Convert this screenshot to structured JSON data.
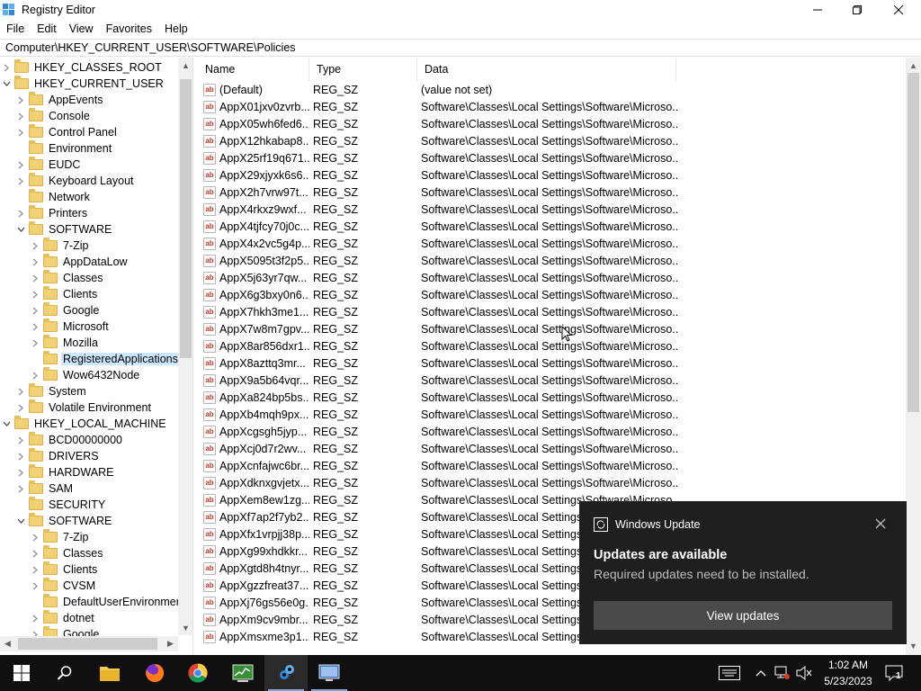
{
  "window": {
    "title": "Registry Editor",
    "minimize_glyph": "—",
    "maximize_glyph": "☐",
    "close_glyph": "✕"
  },
  "menu": [
    "File",
    "Edit",
    "View",
    "Favorites",
    "Help"
  ],
  "address": "Computer\\HKEY_CURRENT_USER\\SOFTWARE\\Policies",
  "tree": [
    {
      "label": "HKEY_CLASSES_ROOT",
      "level": 0,
      "expander": "collapsed"
    },
    {
      "label": "HKEY_CURRENT_USER",
      "level": 0,
      "expander": "expanded"
    },
    {
      "label": "AppEvents",
      "level": 1,
      "expander": "collapsed"
    },
    {
      "label": "Console",
      "level": 1,
      "expander": "collapsed"
    },
    {
      "label": "Control Panel",
      "level": 1,
      "expander": "collapsed"
    },
    {
      "label": "Environment",
      "level": 1,
      "expander": "none"
    },
    {
      "label": "EUDC",
      "level": 1,
      "expander": "collapsed"
    },
    {
      "label": "Keyboard Layout",
      "level": 1,
      "expander": "collapsed"
    },
    {
      "label": "Network",
      "level": 1,
      "expander": "none"
    },
    {
      "label": "Printers",
      "level": 1,
      "expander": "collapsed"
    },
    {
      "label": "SOFTWARE",
      "level": 1,
      "expander": "expanded"
    },
    {
      "label": "7-Zip",
      "level": 2,
      "expander": "collapsed"
    },
    {
      "label": "AppDataLow",
      "level": 2,
      "expander": "collapsed"
    },
    {
      "label": "Classes",
      "level": 2,
      "expander": "collapsed"
    },
    {
      "label": "Clients",
      "level": 2,
      "expander": "collapsed"
    },
    {
      "label": "Google",
      "level": 2,
      "expander": "collapsed"
    },
    {
      "label": "Microsoft",
      "level": 2,
      "expander": "collapsed"
    },
    {
      "label": "Mozilla",
      "level": 2,
      "expander": "collapsed"
    },
    {
      "label": "RegisteredApplications",
      "level": 2,
      "expander": "none",
      "selected": true
    },
    {
      "label": "Wow6432Node",
      "level": 2,
      "expander": "collapsed"
    },
    {
      "label": "System",
      "level": 1,
      "expander": "collapsed"
    },
    {
      "label": "Volatile Environment",
      "level": 1,
      "expander": "collapsed"
    },
    {
      "label": "HKEY_LOCAL_MACHINE",
      "level": 0,
      "expander": "expanded"
    },
    {
      "label": "BCD00000000",
      "level": 1,
      "expander": "collapsed"
    },
    {
      "label": "DRIVERS",
      "level": 1,
      "expander": "collapsed"
    },
    {
      "label": "HARDWARE",
      "level": 1,
      "expander": "collapsed"
    },
    {
      "label": "SAM",
      "level": 1,
      "expander": "collapsed"
    },
    {
      "label": "SECURITY",
      "level": 1,
      "expander": "none"
    },
    {
      "label": "SOFTWARE",
      "level": 1,
      "expander": "expanded"
    },
    {
      "label": "7-Zip",
      "level": 2,
      "expander": "collapsed"
    },
    {
      "label": "Classes",
      "level": 2,
      "expander": "collapsed"
    },
    {
      "label": "Clients",
      "level": 2,
      "expander": "collapsed"
    },
    {
      "label": "CVSM",
      "level": 2,
      "expander": "collapsed"
    },
    {
      "label": "DefaultUserEnvironment",
      "level": 2,
      "expander": "none"
    },
    {
      "label": "dotnet",
      "level": 2,
      "expander": "collapsed"
    },
    {
      "label": "Google",
      "level": 2,
      "expander": "collapsed"
    }
  ],
  "columns": [
    "Name",
    "Type",
    "Data"
  ],
  "values": [
    {
      "name": "(Default)",
      "type": "REG_SZ",
      "data": "(value not set)"
    },
    {
      "name": "AppX01jxv0zvrb...",
      "type": "REG_SZ",
      "data": "Software\\Classes\\Local Settings\\Software\\Microso..."
    },
    {
      "name": "AppX05wh6fed6...",
      "type": "REG_SZ",
      "data": "Software\\Classes\\Local Settings\\Software\\Microso..."
    },
    {
      "name": "AppX12hkabap8...",
      "type": "REG_SZ",
      "data": "Software\\Classes\\Local Settings\\Software\\Microso..."
    },
    {
      "name": "AppX25rf19q671...",
      "type": "REG_SZ",
      "data": "Software\\Classes\\Local Settings\\Software\\Microso..."
    },
    {
      "name": "AppX29xjyxk6s6...",
      "type": "REG_SZ",
      "data": "Software\\Classes\\Local Settings\\Software\\Microso..."
    },
    {
      "name": "AppX2h7vrw97t...",
      "type": "REG_SZ",
      "data": "Software\\Classes\\Local Settings\\Software\\Microso..."
    },
    {
      "name": "AppX4rkxz9wxf...",
      "type": "REG_SZ",
      "data": "Software\\Classes\\Local Settings\\Software\\Microso..."
    },
    {
      "name": "AppX4tjfcy70j0c...",
      "type": "REG_SZ",
      "data": "Software\\Classes\\Local Settings\\Software\\Microso..."
    },
    {
      "name": "AppX4x2vc5g4p...",
      "type": "REG_SZ",
      "data": "Software\\Classes\\Local Settings\\Software\\Microso..."
    },
    {
      "name": "AppX5095t3f2p5...",
      "type": "REG_SZ",
      "data": "Software\\Classes\\Local Settings\\Software\\Microso..."
    },
    {
      "name": "AppX5j63yr7qw...",
      "type": "REG_SZ",
      "data": "Software\\Classes\\Local Settings\\Software\\Microso..."
    },
    {
      "name": "AppX6g3bxy0n6...",
      "type": "REG_SZ",
      "data": "Software\\Classes\\Local Settings\\Software\\Microso..."
    },
    {
      "name": "AppX7hkh3me1...",
      "type": "REG_SZ",
      "data": "Software\\Classes\\Local Settings\\Software\\Microso..."
    },
    {
      "name": "AppX7w8m7gpv...",
      "type": "REG_SZ",
      "data": "Software\\Classes\\Local Settings\\Software\\Microso..."
    },
    {
      "name": "AppX8ar856dxr1...",
      "type": "REG_SZ",
      "data": "Software\\Classes\\Local Settings\\Software\\Microso..."
    },
    {
      "name": "AppX8azttq3mr...",
      "type": "REG_SZ",
      "data": "Software\\Classes\\Local Settings\\Software\\Microso..."
    },
    {
      "name": "AppX9a5b64vqr...",
      "type": "REG_SZ",
      "data": "Software\\Classes\\Local Settings\\Software\\Microso..."
    },
    {
      "name": "AppXa824bp5bs...",
      "type": "REG_SZ",
      "data": "Software\\Classes\\Local Settings\\Software\\Microso..."
    },
    {
      "name": "AppXb4mqh9px...",
      "type": "REG_SZ",
      "data": "Software\\Classes\\Local Settings\\Software\\Microso..."
    },
    {
      "name": "AppXcgsgh5jyp...",
      "type": "REG_SZ",
      "data": "Software\\Classes\\Local Settings\\Software\\Microso..."
    },
    {
      "name": "AppXcj0d7r2wv...",
      "type": "REG_SZ",
      "data": "Software\\Classes\\Local Settings\\Software\\Microso..."
    },
    {
      "name": "AppXcnfajwc6br...",
      "type": "REG_SZ",
      "data": "Software\\Classes\\Local Settings\\Software\\Microso..."
    },
    {
      "name": "AppXdknxgvjetx...",
      "type": "REG_SZ",
      "data": "Software\\Classes\\Local Settings\\Software\\Microso..."
    },
    {
      "name": "AppXem8ew1zg...",
      "type": "REG_SZ",
      "data": "Software\\Classes\\Local Settings\\Software\\Microso..."
    },
    {
      "name": "AppXf7ap2f7yb2...",
      "type": "REG_SZ",
      "data": "Software\\Classes\\Local Settings\\Software\\Microso..."
    },
    {
      "name": "AppXfx1vrpjj38p...",
      "type": "REG_SZ",
      "data": "Software\\Classes\\Local Settings\\Software\\Microso..."
    },
    {
      "name": "AppXg99xhdkkr...",
      "type": "REG_SZ",
      "data": "Software\\Classes\\Local Settings\\Software\\Microso..."
    },
    {
      "name": "AppXgtd8h4tnyr...",
      "type": "REG_SZ",
      "data": "Software\\Classes\\Local Settings\\Software\\Microso..."
    },
    {
      "name": "AppXgzzfreat37...",
      "type": "REG_SZ",
      "data": "Software\\Classes\\Local Settings\\Software\\Microso..."
    },
    {
      "name": "AppXj76gs56e0g...",
      "type": "REG_SZ",
      "data": "Software\\Classes\\Local Settings\\Software\\Microso..."
    },
    {
      "name": "AppXm9cv9mbr...",
      "type": "REG_SZ",
      "data": "Software\\Classes\\Local Settings\\Software\\Microso..."
    },
    {
      "name": "AppXmsxme3p1...",
      "type": "REG_SZ",
      "data": "Software\\Classes\\Local Settings\\Software\\Microso..."
    }
  ],
  "value_icon_text": "ab",
  "toast": {
    "app": "Windows Update",
    "title": "Updates are available",
    "message": "Required updates need to be installed.",
    "button": "View updates"
  },
  "taskbar": {
    "apps": [
      {
        "name": "start",
        "icon": "windows-logo"
      },
      {
        "name": "search",
        "icon": "search-icon"
      },
      {
        "name": "file-explorer",
        "icon": "folder-icon"
      },
      {
        "name": "firefox",
        "icon": "firefox-icon"
      },
      {
        "name": "chrome",
        "icon": "chrome-icon"
      },
      {
        "name": "task-manager",
        "icon": "task-manager-icon"
      },
      {
        "name": "registry-editor",
        "icon": "regedit-icon"
      },
      {
        "name": "remote-desktop",
        "icon": "remote-desktop-icon"
      }
    ],
    "time": "1:02 AM",
    "date": "5/23/2023",
    "notification_count": "1"
  },
  "colors": {
    "selection": "#cce8ff",
    "taskbar": "#101010",
    "toast": "#1f1f1f",
    "toast_button": "#4a4a4a"
  }
}
